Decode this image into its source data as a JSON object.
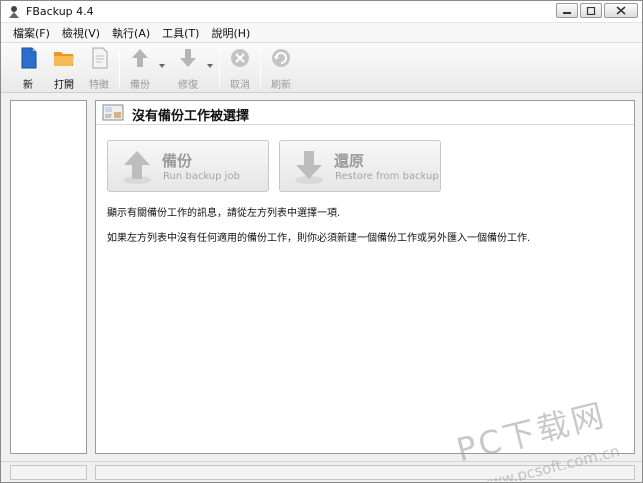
{
  "window": {
    "title": "FBackup  4.4"
  },
  "menu": {
    "items": [
      {
        "id": "file",
        "label": "檔案(F)"
      },
      {
        "id": "view",
        "label": "檢視(V)"
      },
      {
        "id": "execute",
        "label": "執行(A)"
      },
      {
        "id": "tools",
        "label": "工具(T)"
      },
      {
        "id": "help",
        "label": "說明(H)"
      }
    ]
  },
  "toolbar": {
    "new_label": "新",
    "open_label": "打開",
    "properties_label": "特徵",
    "backup_label": "備份",
    "restore_label": "修復",
    "cancel_label": "取消",
    "refresh_label": "刷新"
  },
  "panel": {
    "title": "沒有備份工作被選擇",
    "backup_title": "備份",
    "backup_subtitle": "Run backup job",
    "restore_title": "還原",
    "restore_subtitle": "Restore from backup",
    "message1": "顯示有關備份工作的訊息，請從左方列表中選擇一項.",
    "message2": "如果左方列表中沒有任何適用的備份工作，則你必須新建一個備份工作或另外匯入一個備份工作."
  },
  "watermark": {
    "line1": "PC下载网",
    "line2": "www.pcsoft.com.cn"
  },
  "colors": {
    "accent_blue": "#2a6fc9",
    "folder_orange": "#f2a33a",
    "disabled_gray": "#b5b5b5"
  }
}
